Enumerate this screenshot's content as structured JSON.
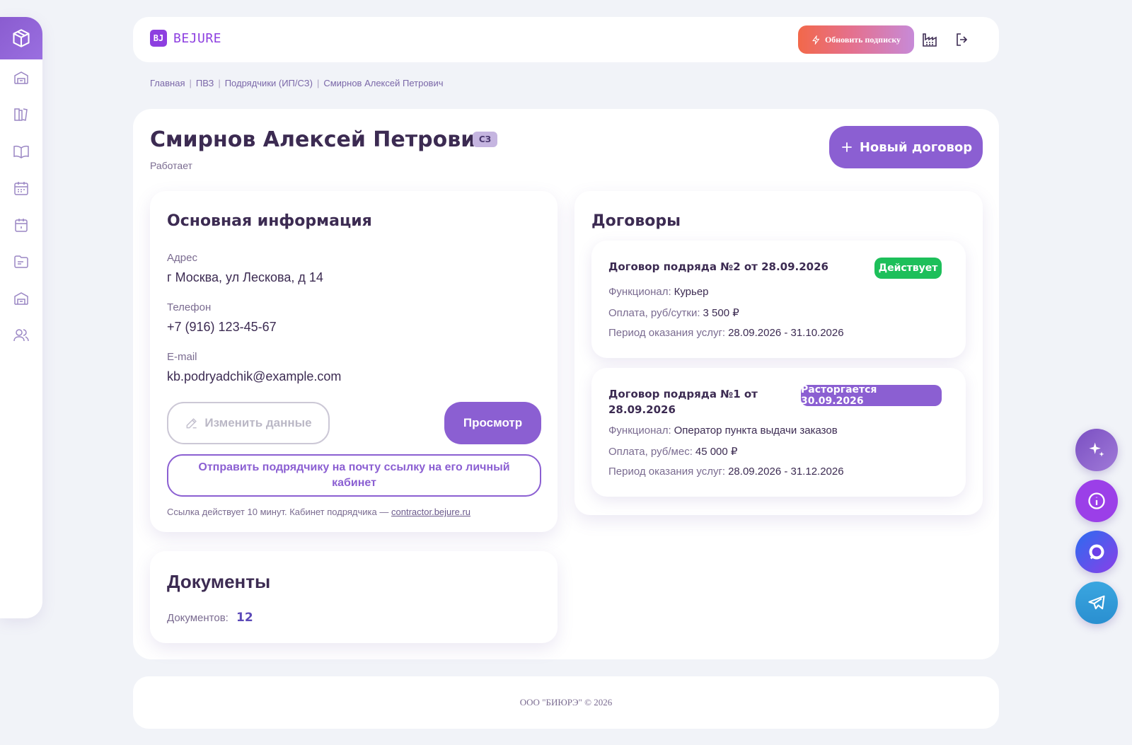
{
  "app": {
    "logo_mark": "BJ",
    "logo_text": "BEJURE"
  },
  "header": {
    "upgrade_label": "Обновить подписку",
    "icons": [
      "factory-icon",
      "logout-icon"
    ]
  },
  "sidebar": {
    "items": [
      "box-icon",
      "warehouse-icon",
      "book-shelf-icon",
      "open-book-icon",
      "calendar-grid-icon",
      "calendar-icon",
      "folder-icon",
      "warehouse-icon-2",
      "users-icon"
    ]
  },
  "breadcrumb": [
    "Главная",
    "ПВЗ",
    "Подрядчики (ИП/СЗ)",
    "Смирнов Алексей Петрович"
  ],
  "profile": {
    "name": "Смирнов Алексей Петрович",
    "type_badge": "СЗ",
    "status": "Работает",
    "new_contract_label": "Новый договор"
  },
  "basic_info": {
    "title": "Основная информация",
    "address_label": "Адрес",
    "address": "г Москва, ул Лескова, д 14",
    "phone_label": "Телефон",
    "phone": "+7 (916) 123-45-67",
    "email_label": "E-mail",
    "email": "kb.podryadchik@example.com",
    "edit_label": "Изменить данные",
    "view_label": "Просмотр",
    "send_label": "Отправить подрядчику на почту ссылку на его личный кабинет",
    "link_note": "Ссылка действует 10 минут. Кабинет подрядчика —",
    "link_url": "contractor.bejure.ru"
  },
  "documents": {
    "title": "Документы",
    "count_label": "Документов:",
    "count": "12"
  },
  "contracts": {
    "title": "Договоры",
    "items": [
      {
        "title": "Договор подряда №2 от 28.09.2026",
        "status": "Действует",
        "status_color": "#1dbf5a",
        "func_label": "Функционал:",
        "func": "Курьер",
        "pay_label": "Оплата, руб/сутки:",
        "pay": "3 500 ₽",
        "period_label": "Период оказания услуг:",
        "period": "28.09.2026 - 31.10.2026"
      },
      {
        "title": "Договор подряда №1 от 28.09.2026",
        "status": "Расторгается 30.09.2026",
        "status_color": "#8b5fd2",
        "func_label": "Функционал:",
        "func": "Оператор пункта выдачи заказов",
        "pay_label": "Оплата, руб/мес:",
        "pay": "45 000 ₽",
        "period_label": "Период оказания услуг:",
        "period": "28.09.2026 - 31.12.2026"
      }
    ]
  },
  "fabs": [
    "sparkle-icon",
    "info-icon",
    "chat-icon",
    "telegram-icon"
  ],
  "footer": {
    "text": "ООО \"БИЮРЭ\" © 2026"
  },
  "colors": {
    "accent": "#8b5fd2",
    "brand": "#8d3fe0",
    "success": "#1dbf5a"
  }
}
